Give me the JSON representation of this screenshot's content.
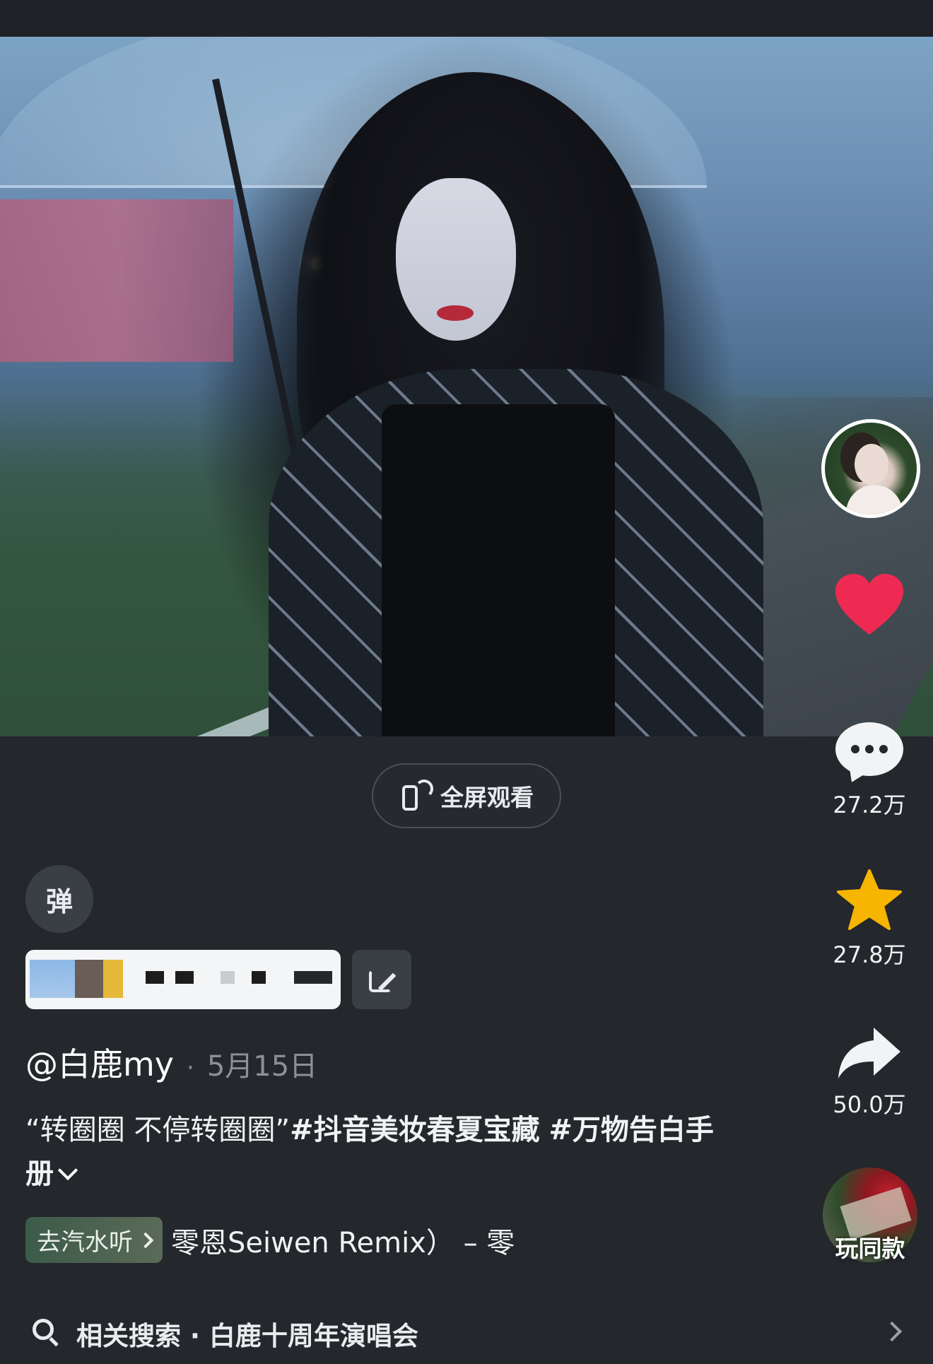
{
  "video": {
    "subject": "woman-with-umbrella-in-rain"
  },
  "fullscreen": {
    "label": "全屏观看"
  },
  "rail": {
    "comments": "27.2万",
    "favorites": "27.8万",
    "shares": "50.0万",
    "play_same": "玩同款"
  },
  "danmu": {
    "toggle_label": "弹"
  },
  "post": {
    "author": "@白鹿my",
    "separator": "·",
    "date": "5月15日",
    "desc_quote": "“转圈圈 不停转圈圈”",
    "tag1": "#抖音美妆春夏宝藏",
    "tag2": "#万物告白手册"
  },
  "music": {
    "tag_label": "去汽水听",
    "title": "零恩Seiwen Remix） – 零"
  },
  "related": {
    "text": "相关搜索 · 白鹿十周年演唱会"
  },
  "colors": {
    "background": "#24272c",
    "heart": "#ee2a52",
    "star": "#f7b500"
  }
}
